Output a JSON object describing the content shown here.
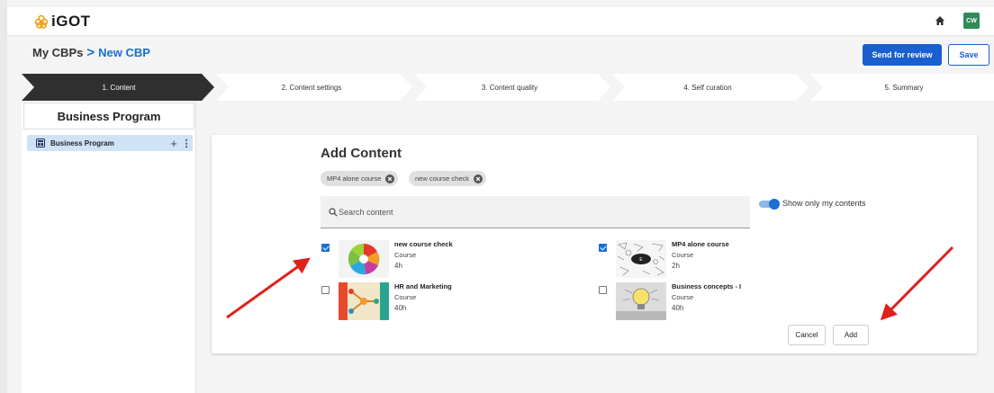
{
  "header": {
    "logo_text": "iGOT",
    "avatar_initials": "CW",
    "icons": [
      "flower-logo-icon",
      "home-icon"
    ]
  },
  "breadcrumb": {
    "parent": "My CBPs",
    "separator": ">",
    "current": "New CBP"
  },
  "actions": {
    "send_review_label": "Send for review",
    "save_label": "Save"
  },
  "steps": [
    {
      "label": "1. Content",
      "active": true
    },
    {
      "label": "2. Content settings",
      "active": false
    },
    {
      "label": "3. Content quality",
      "active": false
    },
    {
      "label": "4. Self curation",
      "active": false
    },
    {
      "label": "5. Summary",
      "active": false
    }
  ],
  "sidebar": {
    "title": "Business Program",
    "items": [
      {
        "label": "Business Program",
        "icon": "module-icon",
        "add": "+",
        "more": "⋮"
      }
    ]
  },
  "panel": {
    "title": "Add Content",
    "chips": [
      "MP4 alone course",
      "new course check"
    ],
    "search": {
      "placeholder": "Search content",
      "value": ""
    },
    "toggle": {
      "label": "Show only my contents",
      "on": true
    },
    "cards": [
      {
        "title": "new course check",
        "type": "Course",
        "duration": "4h",
        "checked": true
      },
      {
        "title": "MP4 alone course",
        "type": "Course",
        "duration": "2h",
        "checked": true
      },
      {
        "title": "HR and Marketing",
        "type": "Course",
        "duration": "40h",
        "checked": false
      },
      {
        "title": "Business concepts - I",
        "type": "Course",
        "duration": "40h",
        "checked": false
      }
    ],
    "cancel_label": "Cancel",
    "add_label": "Add"
  },
  "colors": {
    "primary": "#1a5fcf",
    "active_step": "#2f2f2f",
    "sidebar_item_bg": "#cfe3f7",
    "annotation_arrow": "#e0201b"
  }
}
